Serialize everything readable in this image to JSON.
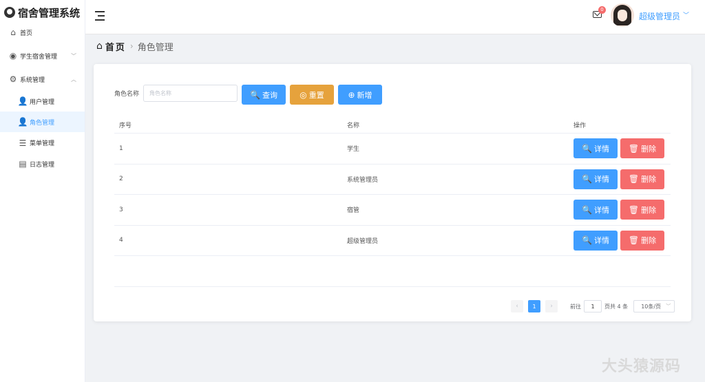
{
  "app": {
    "title": "宿舍管理系统"
  },
  "sidebar": {
    "items": [
      {
        "label": "首页",
        "icon": "home-icon"
      },
      {
        "label": "学生宿舍管理",
        "icon": "target-icon"
      },
      {
        "label": "系统管理",
        "icon": "gear-icon"
      },
      {
        "label": "用户管理",
        "icon": "user-icon"
      },
      {
        "label": "角色管理",
        "icon": "role-icon"
      },
      {
        "label": "菜单管理",
        "icon": "list-icon"
      },
      {
        "label": "日志管理",
        "icon": "document-icon"
      }
    ],
    "active": "角色管理"
  },
  "header": {
    "notification_count": "0",
    "username": "超级管理员"
  },
  "breadcrumb": {
    "home": "首页",
    "current": "角色管理"
  },
  "search": {
    "label": "角色名称",
    "placeholder": "角色名称",
    "query_label": "查询",
    "reset_label": "重置",
    "add_label": "新增"
  },
  "table": {
    "columns": [
      "序号",
      "名称",
      "操作"
    ],
    "rows": [
      {
        "index": "1",
        "name": "学生"
      },
      {
        "index": "2",
        "name": "系统管理员"
      },
      {
        "index": "3",
        "name": "宿管"
      },
      {
        "index": "4",
        "name": "超级管理员"
      }
    ],
    "detail_label": "详情",
    "delete_label": "删除"
  },
  "pagination": {
    "current_page": "1",
    "goto_prefix": "前往",
    "goto_value": "1",
    "total_text": "页共 4 条",
    "page_size": "10条/页"
  },
  "watermark": "大头猿源码",
  "colors": {
    "primary": "#409eff",
    "warning": "#e6a23c",
    "danger": "#f56c6c"
  }
}
